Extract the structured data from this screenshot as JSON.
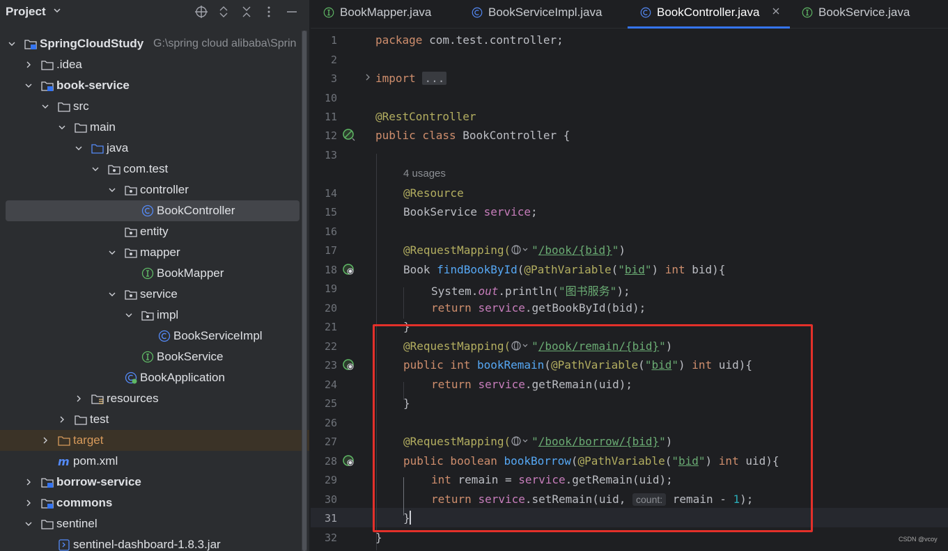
{
  "project_panel": {
    "title": "Project",
    "tree": [
      {
        "label": "SpringCloudStudy",
        "path": "G:\\spring cloud alibaba\\Sprin",
        "depth": 0,
        "expanded": true,
        "icon": "module-folder-icon",
        "bold": true
      },
      {
        "label": ".idea",
        "depth": 1,
        "expanded": false,
        "icon": "folder-icon"
      },
      {
        "label": "book-service",
        "depth": 1,
        "expanded": true,
        "icon": "module-folder-icon",
        "bold": true
      },
      {
        "label": "src",
        "depth": 2,
        "expanded": true,
        "icon": "folder-icon"
      },
      {
        "label": "main",
        "depth": 3,
        "expanded": true,
        "icon": "folder-icon"
      },
      {
        "label": "java",
        "depth": 4,
        "expanded": true,
        "icon": "source-folder-icon"
      },
      {
        "label": "com.test",
        "depth": 5,
        "expanded": true,
        "icon": "package-icon"
      },
      {
        "label": "controller",
        "depth": 6,
        "expanded": true,
        "icon": "package-icon"
      },
      {
        "label": "BookController",
        "depth": 7,
        "icon": "class-icon",
        "selected": true
      },
      {
        "label": "entity",
        "depth": 6,
        "icon": "package-icon"
      },
      {
        "label": "mapper",
        "depth": 6,
        "expanded": true,
        "icon": "package-icon"
      },
      {
        "label": "BookMapper",
        "depth": 7,
        "icon": "interface-icon"
      },
      {
        "label": "service",
        "depth": 6,
        "expanded": true,
        "icon": "package-icon"
      },
      {
        "label": "impl",
        "depth": 7,
        "expanded": true,
        "icon": "package-icon"
      },
      {
        "label": "BookServiceImpl",
        "depth": 8,
        "icon": "class-icon"
      },
      {
        "label": "BookService",
        "depth": 7,
        "icon": "interface-icon"
      },
      {
        "label": "BookApplication",
        "depth": 6,
        "icon": "spring-class-icon"
      },
      {
        "label": "resources",
        "depth": 4,
        "expanded": false,
        "icon": "resources-folder-icon"
      },
      {
        "label": "test",
        "depth": 3,
        "expanded": false,
        "icon": "folder-icon"
      },
      {
        "label": "target",
        "depth": 2,
        "expanded": false,
        "icon": "excluded-folder-icon",
        "excluded": true
      },
      {
        "label": "pom.xml",
        "depth": 2,
        "icon": "maven-icon"
      },
      {
        "label": "borrow-service",
        "depth": 1,
        "expanded": false,
        "icon": "module-folder-icon",
        "bold": true
      },
      {
        "label": "commons",
        "depth": 1,
        "expanded": false,
        "icon": "module-folder-icon",
        "bold": true
      },
      {
        "label": "sentinel",
        "depth": 1,
        "expanded": true,
        "icon": "folder-icon"
      },
      {
        "label": "sentinel-dashboard-1.8.3.jar",
        "depth": 2,
        "icon": "jar-icon"
      }
    ]
  },
  "tabs": [
    {
      "label": "BookMapper.java",
      "icon": "interface-icon",
      "active": false
    },
    {
      "label": "BookServiceImpl.java",
      "icon": "class-icon",
      "active": false
    },
    {
      "label": "BookController.java",
      "icon": "class-icon",
      "active": true
    },
    {
      "label": "BookService.java",
      "icon": "interface-icon",
      "active": false
    }
  ],
  "editor": {
    "line_numbers": [
      "1",
      "2",
      "3",
      "10",
      "11",
      "12",
      "13",
      "14",
      "15",
      "16",
      "17",
      "18",
      "19",
      "20",
      "21",
      "22",
      "23",
      "24",
      "25",
      "26",
      "27",
      "28",
      "29",
      "30",
      "31",
      "32"
    ],
    "current_line": "31",
    "usages_hint": "4 usages",
    "count_hint": "count:",
    "code": {
      "l1_kw": "package",
      "l1_rest": " com.test.controller;",
      "l3_kw": "import",
      "l3_fold": "...",
      "l11_ann": "@RestController",
      "l12_kw": "public class",
      "l12_rest": " BookController {",
      "l14_ann": "@Resource",
      "l15_type": "BookService ",
      "l15_field": "service",
      "l15_end": ";",
      "l17_ann": "@RequestMapping(",
      "l17_q1": "\"",
      "l17_path": "/book/{bid}",
      "l17_q2": "\"",
      "l17_end": ")",
      "l18_a": "Book ",
      "l18_fn": "findBookById",
      "l18_b": "(",
      "l18_ann": "@PathVariable",
      "l18_c": "(",
      "l18_s1": "\"",
      "l18_str": "bid",
      "l18_s2": "\"",
      "l18_d": ") ",
      "l18_kw": "int",
      "l18_e": " bid){",
      "l19_a": "System.",
      "l19_out": "out",
      "l19_b": ".println(",
      "l19_str": "\"图书服务\"",
      "l19_c": ");",
      "l20_kw": "return ",
      "l20_field": "service",
      "l20_rest": ".getBookById(bid);",
      "l21": "}",
      "l22_ann": "@RequestMapping(",
      "l22_q1": "\"",
      "l22_path": "/book/remain/{bid}",
      "l22_q2": "\"",
      "l22_end": ")",
      "l23_kw": "public int ",
      "l23_fn": "bookRemain",
      "l23_b": "(",
      "l23_ann": "@PathVariable",
      "l23_c": "(",
      "l23_s1": "\"",
      "l23_str": "bid",
      "l23_s2": "\"",
      "l23_d": ") ",
      "l23_kw2": "int",
      "l23_e": " uid){",
      "l24_kw": "return ",
      "l24_field": "service",
      "l24_rest": ".getRemain(uid);",
      "l25": "}",
      "l27_ann": "@RequestMapping(",
      "l27_q1": "\"",
      "l27_path": "/book/borrow/{bid}",
      "l27_q2": "\"",
      "l27_end": ")",
      "l28_kw": "public boolean ",
      "l28_fn": "bookBorrow",
      "l28_b": "(",
      "l28_ann": "@PathVariable",
      "l28_c": "(",
      "l28_s1": "\"",
      "l28_str": "bid",
      "l28_s2": "\"",
      "l28_d": ") ",
      "l28_kw2": "int",
      "l28_e": " uid){",
      "l29_kw": "int",
      "l29_a": " remain = ",
      "l29_field": "service",
      "l29_rest": ".getRemain(uid);",
      "l30_kw": "return ",
      "l30_field": "service",
      "l30_a": ".setRemain(uid, ",
      "l30_b": "remain - ",
      "l30_num": "1",
      "l30_c": ");",
      "l31": "}",
      "l32": "}"
    }
  },
  "watermark": "CSDN @vcoy",
  "colors": {
    "highlight_box": "#e3302a",
    "accent": "#3574f0"
  }
}
